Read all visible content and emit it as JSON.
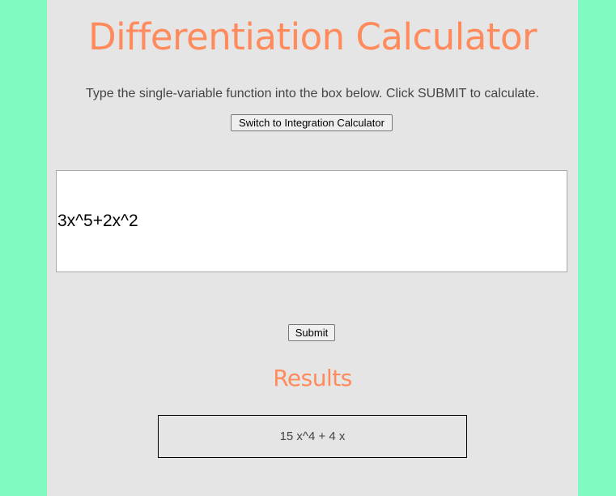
{
  "page": {
    "title": "Differentiation Calculator",
    "instructions": "Type the single-variable function into the box below. Click SUBMIT to calculate.",
    "switch_button_label": "Switch to Integration Calculator",
    "function_input_value": "3x^5+2x^2",
    "submit_button_label": "Submit",
    "results_heading": "Results",
    "result_value": "15 x^4 + 4 x"
  },
  "colors": {
    "background": "#7ffac0",
    "panel": "#e5e5e5",
    "accent": "#ff8a5c",
    "text": "#444444"
  }
}
